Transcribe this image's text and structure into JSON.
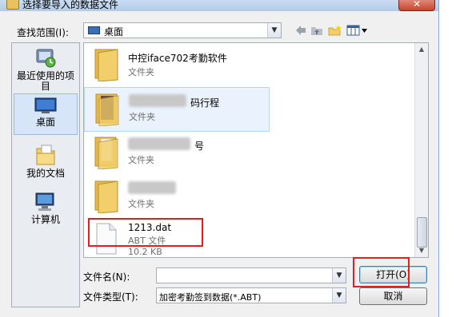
{
  "window": {
    "title": "选择要导入的数据文件",
    "close_label": "✕"
  },
  "toolbar": {
    "lookin_label": "查找范围(I):",
    "lookin_value": "桌面"
  },
  "places": [
    {
      "label": "最近使用的项目",
      "icon": "recent-items-icon"
    },
    {
      "label": "桌面",
      "icon": "desktop-icon"
    },
    {
      "label": "我的文档",
      "icon": "documents-icon"
    },
    {
      "label": "计算机",
      "icon": "computer-icon"
    }
  ],
  "files": [
    {
      "name": "中控iface702考勤软件",
      "type": "文件夹",
      "icon": "folder-icon"
    },
    {
      "name": "码行程",
      "type": "文件夹",
      "icon": "folder-icon"
    },
    {
      "name": "号",
      "type": "文件夹",
      "icon": "folder-icon"
    },
    {
      "name": "",
      "type": "文件夹",
      "icon": "folder-icon"
    },
    {
      "name": "1213.dat",
      "type": "ABT 文件",
      "size": "10.2 KB",
      "icon": "file-icon"
    }
  ],
  "form": {
    "filename_label": "文件名(N):",
    "filename_value": "",
    "filetype_label": "文件类型(T):",
    "filetype_value": "加密考勤签到数据(*.ABT)",
    "open_label": "打开(O)",
    "cancel_label": "取消"
  },
  "colors": {
    "highlight": "#e0201e",
    "folder": "#f2cf6b"
  }
}
